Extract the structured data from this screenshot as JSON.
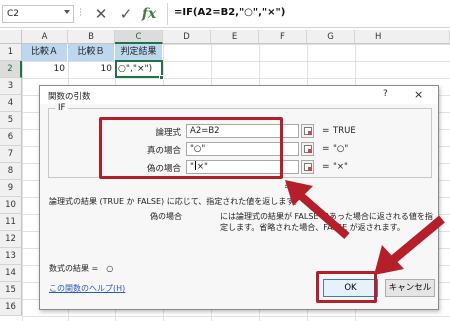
{
  "formula_bar": {
    "name_box": "C2",
    "formula": "=IF(A2=B2,\"○\",\"×\")",
    "fx_label": "fx"
  },
  "grid": {
    "columns": [
      "A",
      "B",
      "C",
      "D",
      "E",
      "F",
      "G",
      "H"
    ],
    "rows": [
      "1",
      "2",
      "3",
      "4",
      "5",
      "6",
      "7",
      "8",
      "9",
      "10",
      "11",
      "12",
      "13",
      "14",
      "15",
      "16",
      "17",
      "18",
      "19"
    ],
    "headers": [
      "比較Ａ",
      "比較Ｂ",
      "判定結果"
    ],
    "row2": {
      "a": "10",
      "b": "10",
      "c": "○\",\"×\")"
    },
    "active_column": "C",
    "active_row": "2"
  },
  "dialog": {
    "title": "関数の引数",
    "help_glyph": "?",
    "close_glyph": "×",
    "function_name": "IF",
    "args": [
      {
        "label": "論理式",
        "value": "A2=B2",
        "result": "TRUE"
      },
      {
        "label": "真の場合",
        "value": "\"○\"",
        "result": "\"○\""
      },
      {
        "label": "偽の場合",
        "value_before": "\"",
        "value_after": "×\"",
        "result": "\"×\""
      }
    ],
    "overall_equals": "=",
    "description": "論理式の結果 (TRUE か FALSE) に応じて、指定された値を返します。",
    "arg_desc_label": "偽の場合",
    "arg_desc_text": "には論理式の結果が FALSE であった場合に返される値を指定します。省略された場合、FALSE が返されます。",
    "formula_result": "数式の結果 =　○",
    "help_link": "この関数のヘルプ(H)",
    "ok_label": "OK",
    "cancel_label": "キャンセル"
  },
  "colors": {
    "highlight": "#b51f2a",
    "excel_green": "#217346",
    "header_fill": "#bdd7ee"
  }
}
